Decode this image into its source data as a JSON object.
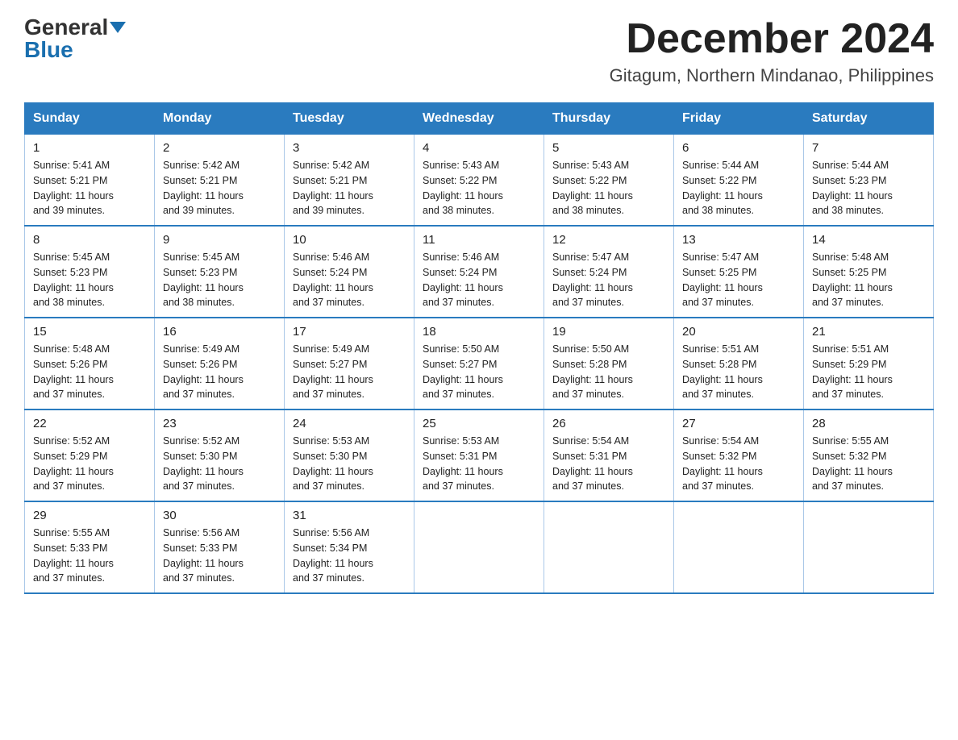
{
  "header": {
    "logo_general": "General",
    "logo_blue": "Blue",
    "month_title": "December 2024",
    "location": "Gitagum, Northern Mindanao, Philippines"
  },
  "days_of_week": [
    "Sunday",
    "Monday",
    "Tuesday",
    "Wednesday",
    "Thursday",
    "Friday",
    "Saturday"
  ],
  "weeks": [
    [
      {
        "day": "1",
        "info": "Sunrise: 5:41 AM\nSunset: 5:21 PM\nDaylight: 11 hours\nand 39 minutes."
      },
      {
        "day": "2",
        "info": "Sunrise: 5:42 AM\nSunset: 5:21 PM\nDaylight: 11 hours\nand 39 minutes."
      },
      {
        "day": "3",
        "info": "Sunrise: 5:42 AM\nSunset: 5:21 PM\nDaylight: 11 hours\nand 39 minutes."
      },
      {
        "day": "4",
        "info": "Sunrise: 5:43 AM\nSunset: 5:22 PM\nDaylight: 11 hours\nand 38 minutes."
      },
      {
        "day": "5",
        "info": "Sunrise: 5:43 AM\nSunset: 5:22 PM\nDaylight: 11 hours\nand 38 minutes."
      },
      {
        "day": "6",
        "info": "Sunrise: 5:44 AM\nSunset: 5:22 PM\nDaylight: 11 hours\nand 38 minutes."
      },
      {
        "day": "7",
        "info": "Sunrise: 5:44 AM\nSunset: 5:23 PM\nDaylight: 11 hours\nand 38 minutes."
      }
    ],
    [
      {
        "day": "8",
        "info": "Sunrise: 5:45 AM\nSunset: 5:23 PM\nDaylight: 11 hours\nand 38 minutes."
      },
      {
        "day": "9",
        "info": "Sunrise: 5:45 AM\nSunset: 5:23 PM\nDaylight: 11 hours\nand 38 minutes."
      },
      {
        "day": "10",
        "info": "Sunrise: 5:46 AM\nSunset: 5:24 PM\nDaylight: 11 hours\nand 37 minutes."
      },
      {
        "day": "11",
        "info": "Sunrise: 5:46 AM\nSunset: 5:24 PM\nDaylight: 11 hours\nand 37 minutes."
      },
      {
        "day": "12",
        "info": "Sunrise: 5:47 AM\nSunset: 5:24 PM\nDaylight: 11 hours\nand 37 minutes."
      },
      {
        "day": "13",
        "info": "Sunrise: 5:47 AM\nSunset: 5:25 PM\nDaylight: 11 hours\nand 37 minutes."
      },
      {
        "day": "14",
        "info": "Sunrise: 5:48 AM\nSunset: 5:25 PM\nDaylight: 11 hours\nand 37 minutes."
      }
    ],
    [
      {
        "day": "15",
        "info": "Sunrise: 5:48 AM\nSunset: 5:26 PM\nDaylight: 11 hours\nand 37 minutes."
      },
      {
        "day": "16",
        "info": "Sunrise: 5:49 AM\nSunset: 5:26 PM\nDaylight: 11 hours\nand 37 minutes."
      },
      {
        "day": "17",
        "info": "Sunrise: 5:49 AM\nSunset: 5:27 PM\nDaylight: 11 hours\nand 37 minutes."
      },
      {
        "day": "18",
        "info": "Sunrise: 5:50 AM\nSunset: 5:27 PM\nDaylight: 11 hours\nand 37 minutes."
      },
      {
        "day": "19",
        "info": "Sunrise: 5:50 AM\nSunset: 5:28 PM\nDaylight: 11 hours\nand 37 minutes."
      },
      {
        "day": "20",
        "info": "Sunrise: 5:51 AM\nSunset: 5:28 PM\nDaylight: 11 hours\nand 37 minutes."
      },
      {
        "day": "21",
        "info": "Sunrise: 5:51 AM\nSunset: 5:29 PM\nDaylight: 11 hours\nand 37 minutes."
      }
    ],
    [
      {
        "day": "22",
        "info": "Sunrise: 5:52 AM\nSunset: 5:29 PM\nDaylight: 11 hours\nand 37 minutes."
      },
      {
        "day": "23",
        "info": "Sunrise: 5:52 AM\nSunset: 5:30 PM\nDaylight: 11 hours\nand 37 minutes."
      },
      {
        "day": "24",
        "info": "Sunrise: 5:53 AM\nSunset: 5:30 PM\nDaylight: 11 hours\nand 37 minutes."
      },
      {
        "day": "25",
        "info": "Sunrise: 5:53 AM\nSunset: 5:31 PM\nDaylight: 11 hours\nand 37 minutes."
      },
      {
        "day": "26",
        "info": "Sunrise: 5:54 AM\nSunset: 5:31 PM\nDaylight: 11 hours\nand 37 minutes."
      },
      {
        "day": "27",
        "info": "Sunrise: 5:54 AM\nSunset: 5:32 PM\nDaylight: 11 hours\nand 37 minutes."
      },
      {
        "day": "28",
        "info": "Sunrise: 5:55 AM\nSunset: 5:32 PM\nDaylight: 11 hours\nand 37 minutes."
      }
    ],
    [
      {
        "day": "29",
        "info": "Sunrise: 5:55 AM\nSunset: 5:33 PM\nDaylight: 11 hours\nand 37 minutes."
      },
      {
        "day": "30",
        "info": "Sunrise: 5:56 AM\nSunset: 5:33 PM\nDaylight: 11 hours\nand 37 minutes."
      },
      {
        "day": "31",
        "info": "Sunrise: 5:56 AM\nSunset: 5:34 PM\nDaylight: 11 hours\nand 37 minutes."
      },
      null,
      null,
      null,
      null
    ]
  ]
}
